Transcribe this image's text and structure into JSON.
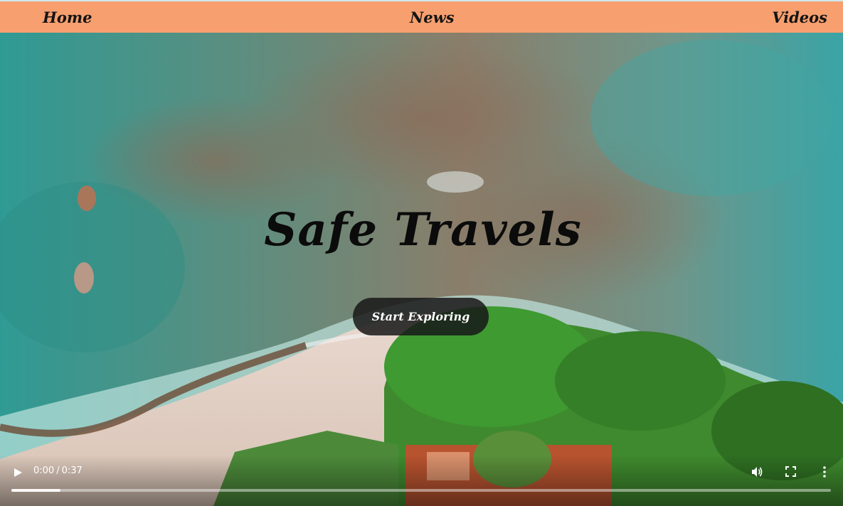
{
  "nav": {
    "home": "Home",
    "news": "News",
    "videos": "Videos",
    "background_color": "#f79f6f"
  },
  "hero": {
    "title": "Safe Travels",
    "cta_label": "Start Exploring"
  },
  "video": {
    "current_time": "0:00",
    "duration": "0:37",
    "time_separator": "/",
    "progress_buffered_fraction": 0.06,
    "icons": [
      "play-icon",
      "volume-icon",
      "fullscreen-icon",
      "more-options-icon"
    ]
  }
}
